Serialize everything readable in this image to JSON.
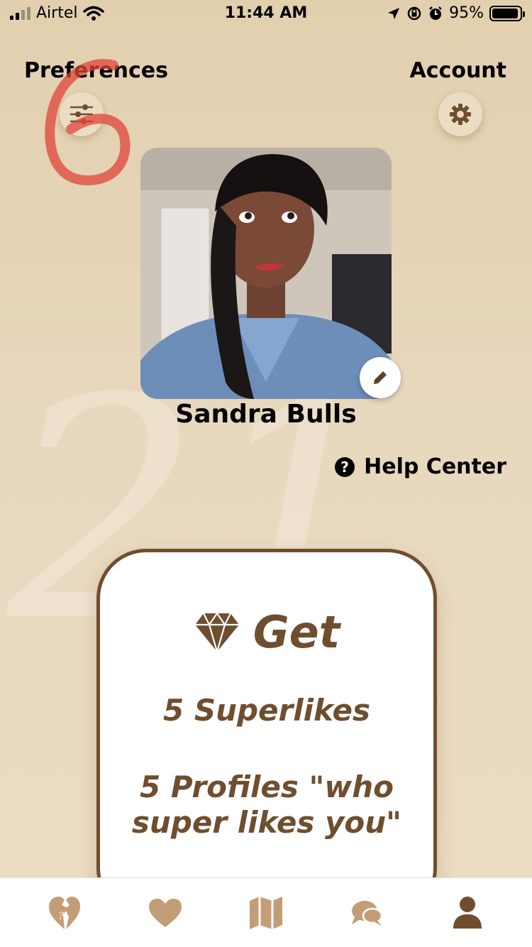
{
  "status_bar": {
    "carrier": "Airtel",
    "time": "11:44 AM",
    "battery": "95%",
    "battery_level": 0.95
  },
  "header": {
    "preferences_label": "Preferences",
    "account_label": "Account",
    "preferences_icon": "sliders-icon",
    "account_icon": "gear-icon",
    "annotation_digit": "6"
  },
  "profile": {
    "name": "Sandra Bulls",
    "edit_icon": "pencil-icon"
  },
  "help": {
    "label": "Help Center",
    "icon": "question-circle-icon"
  },
  "promo": {
    "title": "Get",
    "icon": "diamond-icon",
    "line1": "5 Superlikes",
    "line2a": "5 Profiles \"who",
    "line2b": "super likes you\""
  },
  "tabs": [
    {
      "icon": "heart-question-icon"
    },
    {
      "icon": "heart-icon"
    },
    {
      "icon": "map-icon"
    },
    {
      "icon": "chat-bubbles-icon"
    },
    {
      "icon": "person-icon",
      "active": true
    }
  ],
  "colors": {
    "brand_brown": "#6f4e2f",
    "icon_tan": "#c39d76",
    "background": "#e6d4b6"
  }
}
